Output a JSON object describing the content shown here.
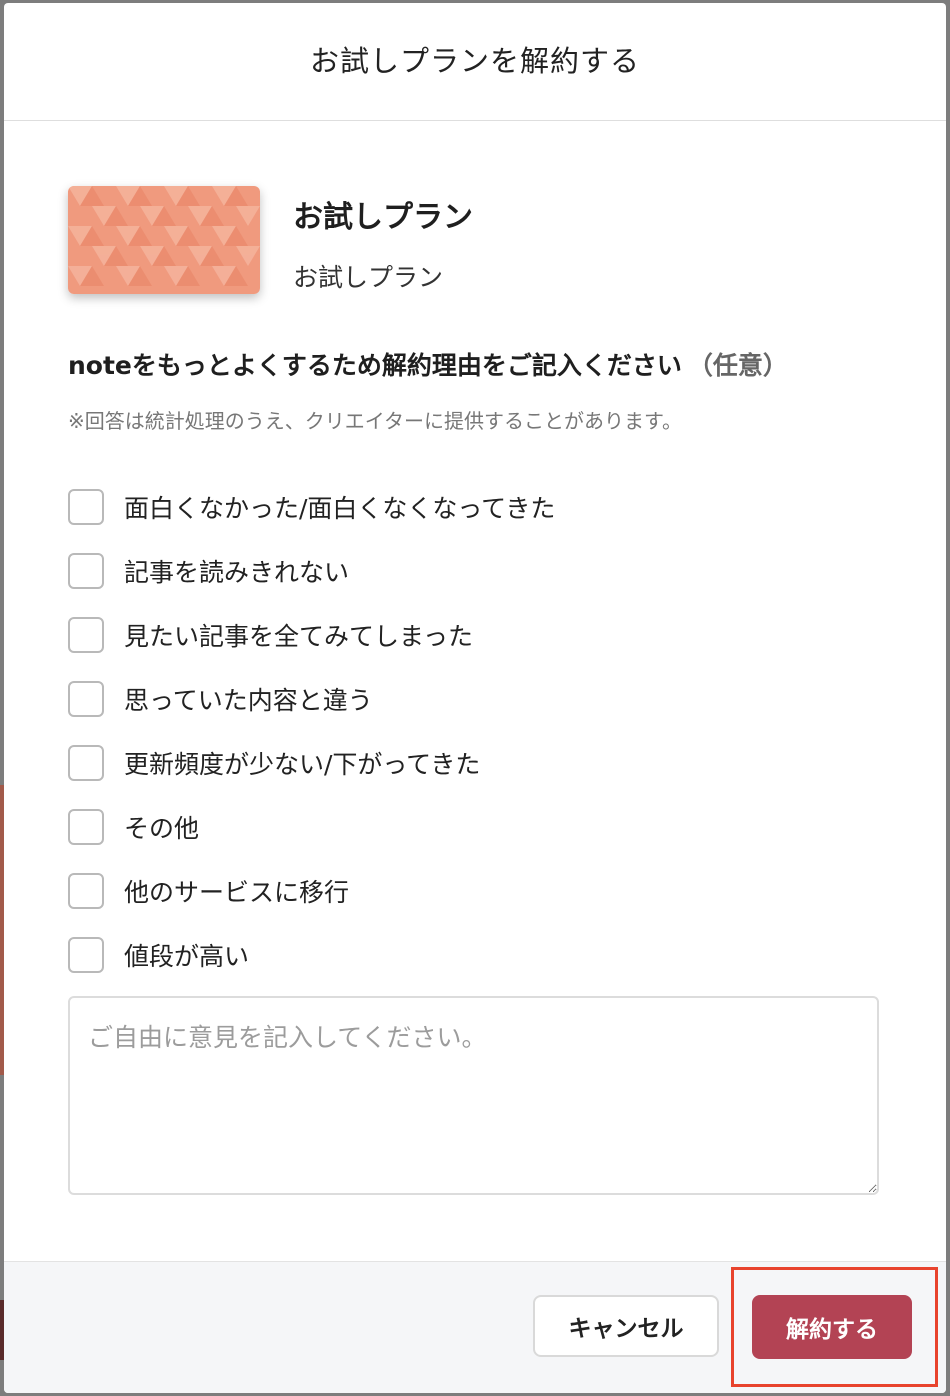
{
  "modal": {
    "title": "お試しプランを解約する"
  },
  "plan": {
    "name": "お試しプラン",
    "description": "お試しプラン",
    "card_color": "#f09a7e"
  },
  "survey": {
    "question": "noteをもっとよくするため解約理由をご記入ください",
    "optional_tag": "（任意）",
    "note": "※回答は統計処理のうえ、クリエイターに提供することがあります。",
    "reasons": [
      "面白くなかった/面白くなくなってきた",
      "記事を読みきれない",
      "見たい記事を全てみてしまった",
      "思っていた内容と違う",
      "更新頻度が少ない/下がってきた",
      "その他",
      "他のサービスに移行",
      "値段が高い"
    ],
    "comment_placeholder": "ご自由に意見を記入してください。",
    "comment_value": ""
  },
  "footer": {
    "cancel_label": "キャンセル",
    "confirm_label": "解約する",
    "confirm_color": "#b34354",
    "highlight_color": "#e8432d"
  }
}
